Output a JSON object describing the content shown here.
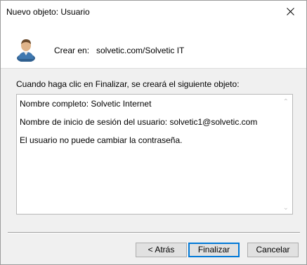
{
  "window": {
    "title": "Nuevo objeto: Usuario"
  },
  "header": {
    "create_label": "Crear en:",
    "create_value": "solvetic.com/Solvetic IT",
    "icon": "user-icon"
  },
  "lead_text": "Cuando haga clic en Finalizar, se creará el siguiente objeto:",
  "summary": {
    "lines": [
      "Nombre completo: Solvetic Internet",
      "Nombre de inicio de sesión del usuario: solvetic1@solvetic.com",
      "El usuario no puede cambiar la contraseña."
    ]
  },
  "buttons": {
    "back": "< Atrás",
    "finish": "Finalizar",
    "cancel": "Cancelar"
  },
  "colors": {
    "accent": "#0078d7",
    "dialog_bg": "#f0f0f0"
  }
}
